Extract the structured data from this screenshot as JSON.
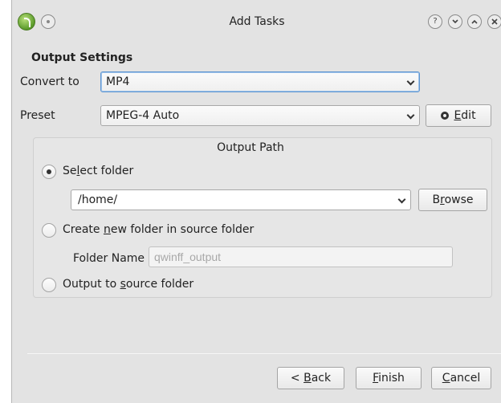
{
  "window": {
    "title": "Add Tasks",
    "help_glyph": "?"
  },
  "output_settings": {
    "heading": "Output Settings",
    "convert_to_label": "Convert to",
    "convert_to_value": "MP4",
    "preset_label": "Preset",
    "preset_value": "MPEG-4 Auto",
    "edit_button": {
      "before": "",
      "mnemonic": "E",
      "after": "dit"
    }
  },
  "output_path": {
    "title": "Output Path",
    "select_folder": {
      "before": "Se",
      "mnemonic": "l",
      "after": "ect folder",
      "checked": true
    },
    "folder_value": "/home/",
    "browse_button": {
      "before": "B",
      "mnemonic": "r",
      "after": "owse"
    },
    "create_folder": {
      "before": "Create ",
      "mnemonic": "n",
      "after": "ew folder in source folder",
      "checked": false
    },
    "folder_name_label": "Folder Name",
    "folder_name_placeholder": "qwinff_output",
    "output_to_source": {
      "before": "Output to ",
      "mnemonic": "s",
      "after": "ource folder",
      "checked": false
    }
  },
  "footer": {
    "back_button": {
      "before": "< ",
      "mnemonic": "B",
      "after": "ack"
    },
    "finish_button": {
      "before": "",
      "mnemonic": "F",
      "after": "inish"
    },
    "cancel_button": {
      "before": "",
      "mnemonic": "C",
      "after": "ancel"
    }
  },
  "colors": {
    "window_bg": "#e3e3e3",
    "focus_border": "#5e95d0"
  }
}
